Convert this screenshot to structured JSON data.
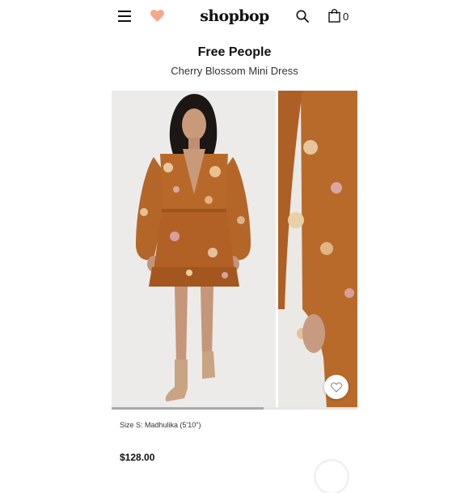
{
  "header": {
    "logo": "shopbop",
    "menu_icon": "hamburger-menu-icon",
    "wishlist_icon": "heart-icon",
    "search_icon": "search-icon",
    "bag_icon": "shopping-bag-icon",
    "bag_count": "0",
    "accent_color": "#f2a98a"
  },
  "product": {
    "brand": "Free People",
    "name": "Cherry Blossom Mini Dress",
    "size_info": "Size S: Madhulika (5'10\")",
    "price": "$128.00"
  },
  "gallery": {
    "images": [
      {
        "name": "model-front-full-photo",
        "dress_color": "#b8692a"
      },
      {
        "name": "sleeve-detail-photo",
        "dress_color": "#b86a2b"
      }
    ],
    "progress": 0.62,
    "wishlist_button_icon": "heart-outline-icon"
  }
}
